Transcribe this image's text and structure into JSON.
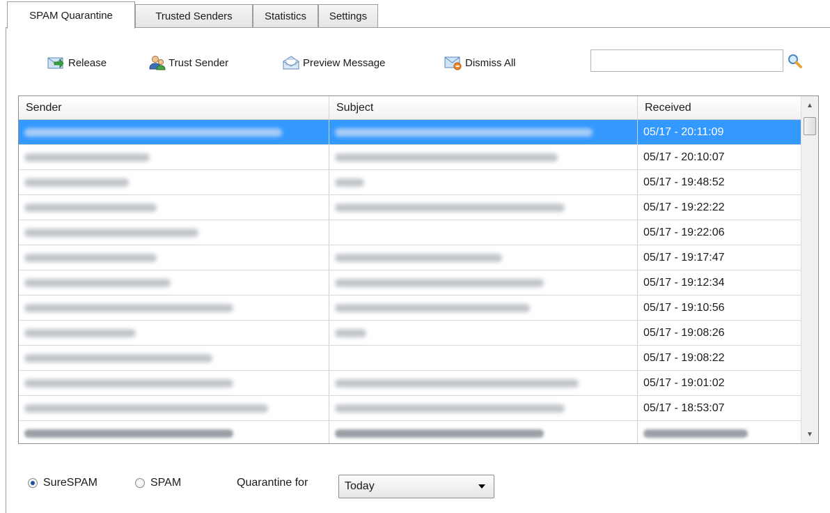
{
  "tabs": [
    {
      "label": "SPAM Quarantine"
    },
    {
      "label": "Trusted Senders"
    },
    {
      "label": "Statistics"
    },
    {
      "label": "Settings"
    }
  ],
  "toolbar": {
    "release": "Release",
    "trust_sender": "Trust Sender",
    "preview_message": "Preview Message",
    "dismiss_all": "Dismiss All",
    "search_value": "",
    "search_icon": "magnifier-icon"
  },
  "grid": {
    "columns": [
      "Sender",
      "Subject",
      "Received"
    ],
    "rows": [
      {
        "received": "05/17 - 20:11:09"
      },
      {
        "received": "05/17 - 20:10:07"
      },
      {
        "received": "05/17 - 19:48:52"
      },
      {
        "received": "05/17 - 19:22:22"
      },
      {
        "received": "05/17 - 19:22:06"
      },
      {
        "received": "05/17 - 19:17:47"
      },
      {
        "received": "05/17 - 19:12:34"
      },
      {
        "received": "05/17 - 19:10:56"
      },
      {
        "received": "05/17 - 19:08:26"
      },
      {
        "received": "05/17 - 19:08:22"
      },
      {
        "received": "05/17 - 19:01:02"
      },
      {
        "received": "05/17 - 18:53:07"
      }
    ],
    "selected_row": 0
  },
  "filters": {
    "surespam_label": "SureSPAM",
    "spam_label": "SPAM",
    "selected": "SureSPAM",
    "quarantine_label": "Quarantine for",
    "quarantine_value": "Today"
  },
  "colors": {
    "selection": "#3399ff"
  }
}
